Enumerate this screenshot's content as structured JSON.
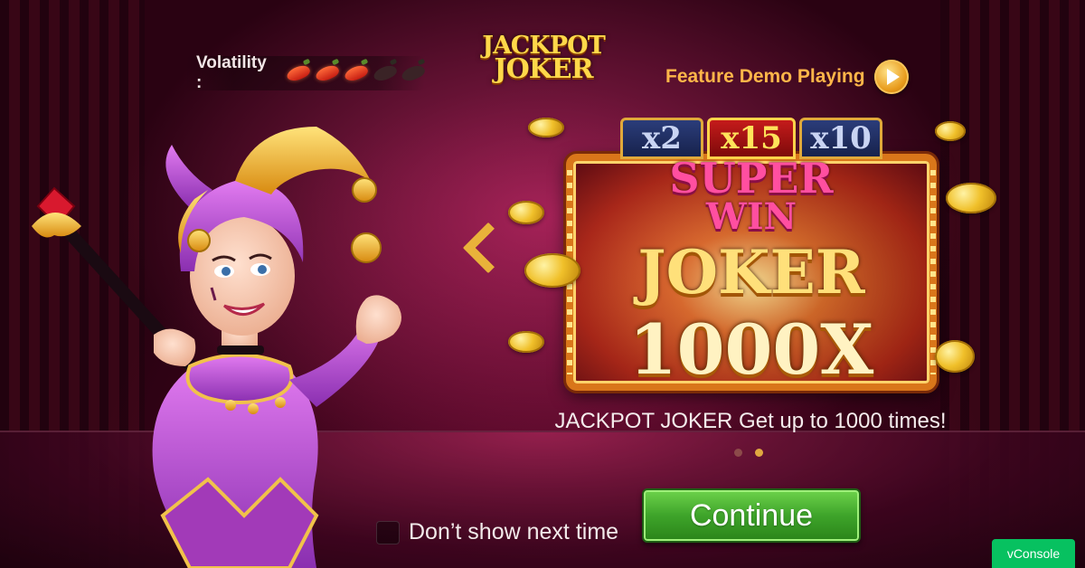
{
  "header": {
    "volatility_label": "Volatility :",
    "volatility_level": 3,
    "volatility_max": 5,
    "logo_line1": "JACKPOT",
    "logo_line2": "JOKER",
    "demo_label": "Feature Demo Playing"
  },
  "slide": {
    "multipliers": [
      "x2",
      "x15",
      "x10"
    ],
    "title_line1": "SUPER",
    "title_line2": "WIN",
    "title_line3": "JOKER",
    "title_line4": "1000X",
    "caption": "JACKPOT JOKER Get up to 1000 times!"
  },
  "carousel": {
    "total_slides": 2,
    "active_index": 1
  },
  "footer": {
    "dont_show_label": "Don’t show next time",
    "continue_label": "Continue"
  },
  "vconsole_label": "vConsole",
  "colors": {
    "continue_green": "#3ea42a",
    "accent_orange": "#ffb649",
    "vconsole_green": "#07c160"
  }
}
